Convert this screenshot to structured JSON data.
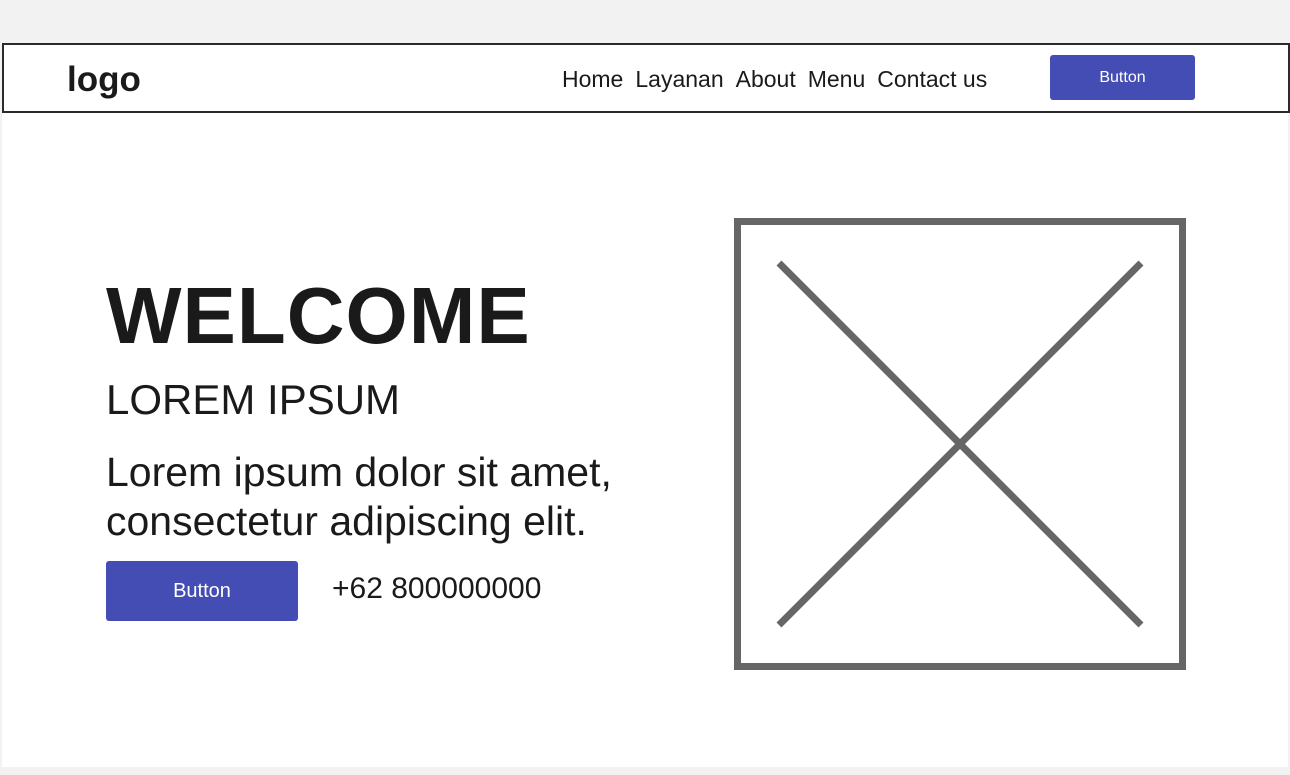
{
  "header": {
    "logo": "logo",
    "nav": [
      "Home",
      "Layanan",
      "About",
      "Menu",
      "Contact us"
    ],
    "button_label": "Button"
  },
  "hero": {
    "title": "WELCOME",
    "subtitle": "LOREM IPSUM",
    "text": "Lorem ipsum dolor sit amet, consectetur adipiscing elit.",
    "button_label": "Button",
    "phone": "+62 800000000"
  },
  "colors": {
    "accent": "#434db4",
    "placeholder_stroke": "#666666",
    "background": "#f2f2f2"
  },
  "icons": {
    "image_placeholder": "image-placeholder-icon"
  }
}
